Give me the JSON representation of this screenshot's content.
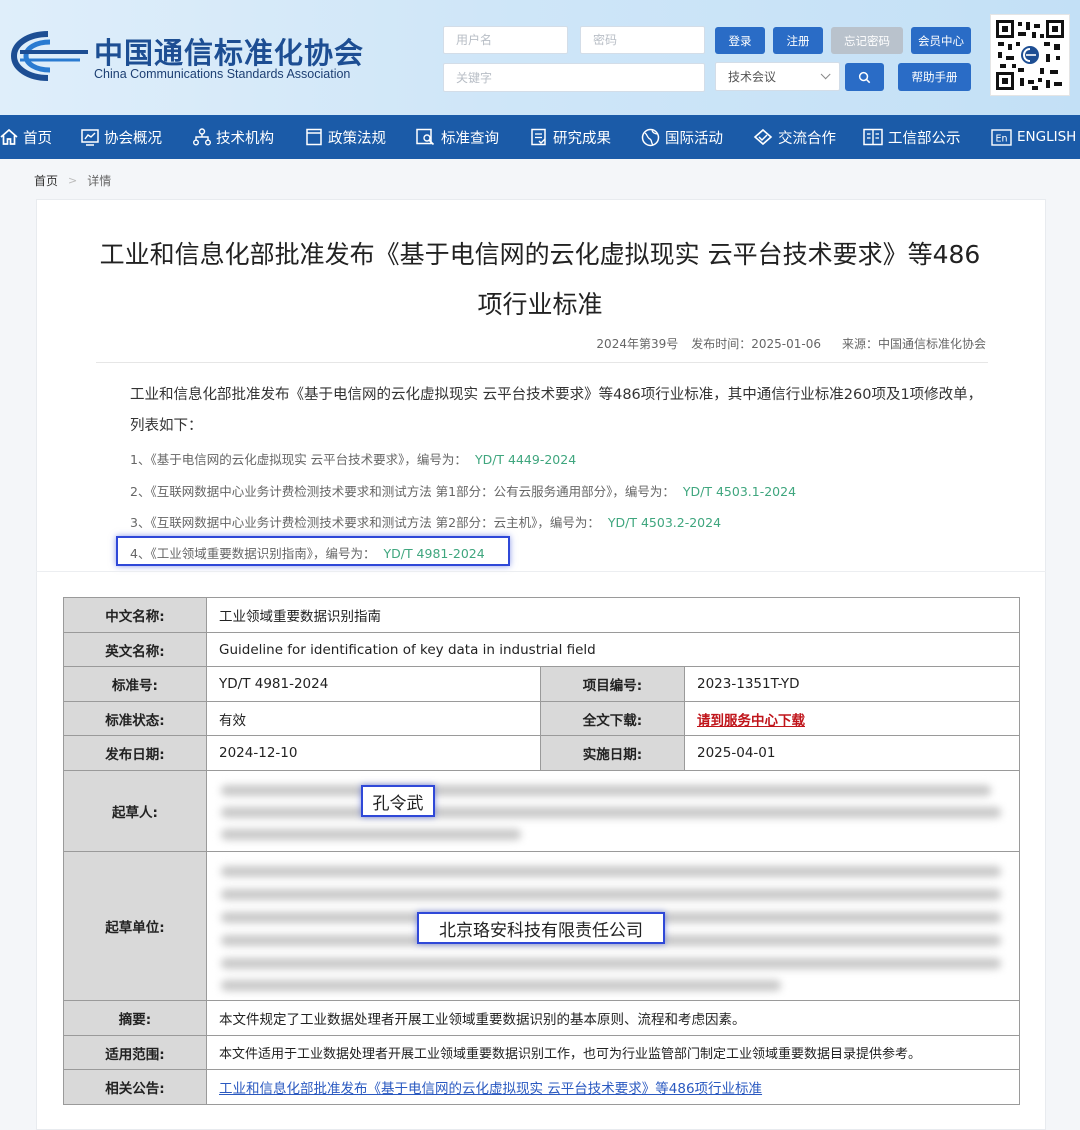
{
  "site": {
    "name_cn": "中国通信标准化协会",
    "name_en": "China Communications Standards Association"
  },
  "login": {
    "username_placeholder": "用户名",
    "password_placeholder": "密码",
    "login_label": "登录",
    "register_label": "注册",
    "forgot_label": "忘记密码",
    "member_label": "会员中心",
    "keyword_placeholder": "关键字",
    "category_selected": "技术会议",
    "help_label": "帮助手册"
  },
  "nav": [
    {
      "label": "首页",
      "icon": "home-icon"
    },
    {
      "label": "协会概况",
      "icon": "chart-icon"
    },
    {
      "label": "技术机构",
      "icon": "org-icon"
    },
    {
      "label": "政策法规",
      "icon": "document-icon"
    },
    {
      "label": "标准查询",
      "icon": "search-doc-icon"
    },
    {
      "label": "研究成果",
      "icon": "report-icon"
    },
    {
      "label": "国际活动",
      "icon": "globe-icon"
    },
    {
      "label": "交流合作",
      "icon": "handshake-icon"
    },
    {
      "label": "工信部公示",
      "icon": "notice-icon"
    },
    {
      "label": "ENGLISH",
      "icon": "en-icon"
    }
  ],
  "breadcrumb": {
    "home": "首页",
    "current": "详情"
  },
  "article": {
    "title_line1": "工业和信息化部批准发布《基于电信网的云化虚拟现实 云平台技术要求》等486",
    "title_line2": "项行业标准",
    "issue": "2024年第39号",
    "publish_time": "发布时间：2025-01-06",
    "source": "来源：中国通信标准化协会",
    "intro": "工业和信息化部批准发布《基于电信网的云化虚拟现实 云平台技术要求》等486项行业标准，其中通信行业标准260项及1项修改单，列表如下：",
    "items": [
      {
        "text": "1、《基于电信网的云化虚拟现实 云平台技术要求》，编号为：",
        "code": "YD/T 4449-2024"
      },
      {
        "text": "2、《互联网数据中心业务计费检测技术要求和测试方法 第1部分：公有云服务通用部分》，编号为：",
        "code": "YD/T 4503.1-2024"
      },
      {
        "text": "3、《互联网数据中心业务计费检测技术要求和测试方法 第2部分：云主机》，编号为：",
        "code": "YD/T 4503.2-2024"
      },
      {
        "text": "4、《工业领域重要数据识别指南》，编号为：",
        "code": "YD/T 4981-2024"
      }
    ]
  },
  "spec": {
    "cn_name_label": "中文名称:",
    "cn_name": "工业领域重要数据识别指南",
    "en_name_label": "英文名称:",
    "en_name": "Guideline for identification of key data in industrial field",
    "std_no_label": "标准号:",
    "std_no": "YD/T 4981-2024",
    "project_no_label": "项目编号:",
    "project_no": "2023-1351T-YD",
    "status_label": "标准状态:",
    "status": "有效",
    "download_label": "全文下载:",
    "download": "请到服务中心下载",
    "publish_date_label": "发布日期:",
    "publish_date": "2024-12-10",
    "impl_date_label": "实施日期:",
    "impl_date": "2025-04-01",
    "drafters_label": "起草人:",
    "drafter_highlight": "孔令武",
    "units_label": "起草单位:",
    "unit_highlight": "北京珞安科技有限责任公司",
    "abstract_label": "摘要:",
    "abstract": "本文件规定了工业数据处理者开展工业领域重要数据识别的基本原则、流程和考虑因素。",
    "scope_label": "适用范围:",
    "scope": "本文件适用于工业数据处理者开展工业领域重要数据识别工作，也可为行业监管部门制定工业领域重要数据目录提供参考。",
    "related_label": "相关公告:",
    "related": "工业和信息化部批准发布《基于电信网的云化虚拟现实 云平台技术要求》等486项行业标准"
  },
  "colors": {
    "nav_bg": "#1b5ba8",
    "brand_blue": "#1d4e93",
    "code_green": "#3fa67e",
    "highlight_blue": "#2f48d8",
    "download_red": "#c0151b"
  }
}
